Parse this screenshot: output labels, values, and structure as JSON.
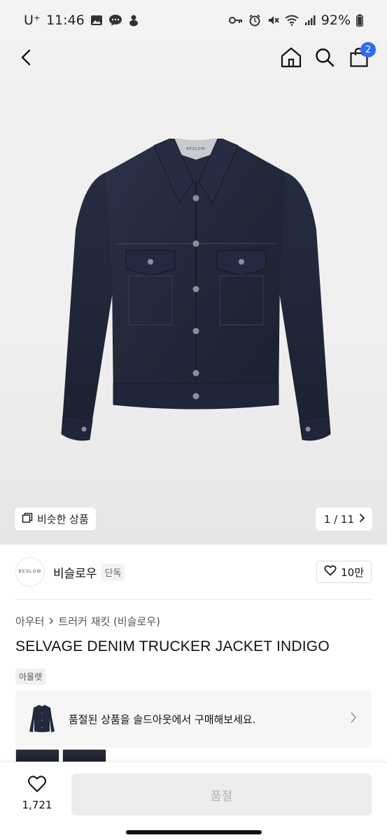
{
  "status_bar": {
    "carrier": "U⁺",
    "time": "11:46",
    "battery": "92%"
  },
  "nav": {
    "cart_count": "2"
  },
  "hero": {
    "similar_label": "비슷한 상품",
    "page_indicator": "1 / 11",
    "jacket_label_text": "BESLOW"
  },
  "brand": {
    "logo_text": "BESLOW",
    "name": "비슬로우",
    "tag": "단독",
    "likes": "10만"
  },
  "breadcrumb": {
    "level1": "아우터",
    "level2": "트러커 재킷 (비슬로우)"
  },
  "product": {
    "title": "SELVAGE DENIM TRUCKER JACKET INDIGO",
    "tag": "아울렛"
  },
  "banner": {
    "text": "품절된 상품을 솔드아웃에서 구매해보세요."
  },
  "bottom": {
    "wish_count": "1,721",
    "buy_label": "품절"
  },
  "colors": {
    "accent": "#2f6cf0",
    "denim": "#242a3d"
  }
}
